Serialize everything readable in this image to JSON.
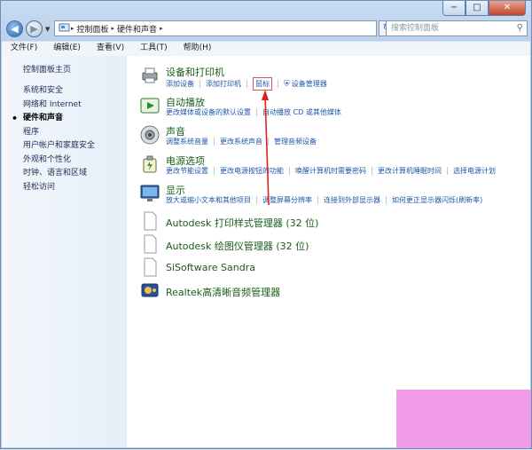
{
  "caption": {
    "min": "−",
    "max": "□",
    "close": "✕"
  },
  "nav": {
    "back": "◀",
    "forward": "▶",
    "history": "▼",
    "path": [
      "控制面板",
      "硬件和声音"
    ],
    "refresh": "↻",
    "search_placeholder": "搜索控制面板",
    "search_icon": "search-icon"
  },
  "menu": [
    "文件(F)",
    "编辑(E)",
    "查看(V)",
    "工具(T)",
    "帮助(H)"
  ],
  "left": {
    "home": "控制面板主页",
    "items": [
      {
        "label": "系统和安全"
      },
      {
        "label": "网络和 Internet"
      },
      {
        "label": "硬件和声音",
        "active": true
      },
      {
        "label": "程序"
      },
      {
        "label": "用户帐户和家庭安全"
      },
      {
        "label": "外观和个性化"
      },
      {
        "label": "时钟、语言和区域"
      },
      {
        "label": "轻松访问"
      }
    ]
  },
  "sections": [
    {
      "title": "设备和打印机",
      "links": [
        "添加设备",
        "添加打印机",
        "鼠标",
        "设备管理器"
      ]
    },
    {
      "title": "自动播放",
      "links": [
        "更改媒体或设备的默认设置",
        "自动播放 CD 或其他媒体"
      ]
    },
    {
      "title": "声音",
      "links": [
        "调整系统音量",
        "更改系统声音",
        "管理音频设备"
      ]
    },
    {
      "title": "电源选项",
      "links": [
        "更改节能设置",
        "更改电源按钮的功能",
        "唤醒计算机时需要密码",
        "更改计算机睡眠时间",
        "选择电源计划"
      ]
    },
    {
      "title": "显示",
      "links": [
        "放大或缩小文本和其他项目",
        "调整屏幕分辨率",
        "连接到外部显示器",
        "如何更正显示器闪烁(刷新率)"
      ]
    }
  ],
  "apps": [
    {
      "title": "Autodesk 打印样式管理器 (32 位)"
    },
    {
      "title": "Autodesk 绘图仪管理器 (32 位)"
    },
    {
      "title": "SiSoftware Sandra"
    },
    {
      "title": "Realtek高清晰音频管理器"
    }
  ],
  "colors": {
    "link": "#1f57a8",
    "heading": "#1a5c1a",
    "arrow": "#e02020",
    "watermark": "#ef9be7"
  }
}
